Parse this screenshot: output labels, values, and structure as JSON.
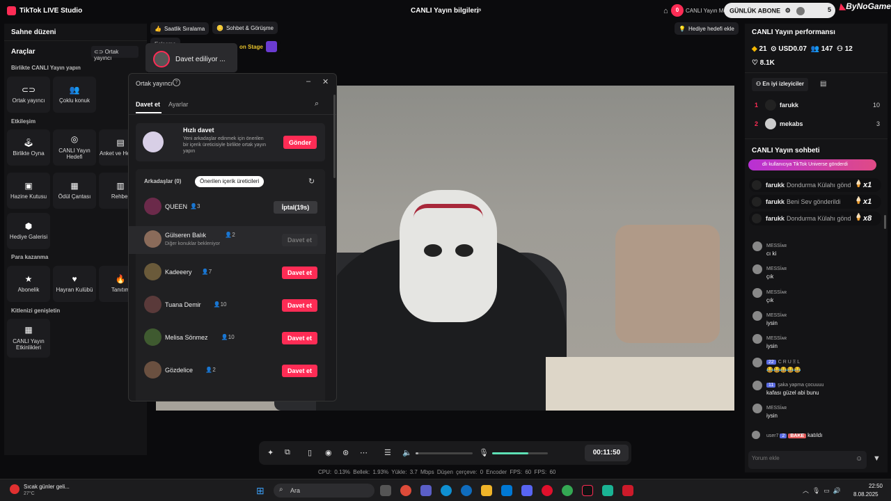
{
  "app": {
    "title": "TikTok LIVE Studio",
    "center_title": "CANLI Yayın bilgileri"
  },
  "topbar": {
    "notif_count": "0",
    "stream_label": "CANLI Yayın Merkezi",
    "banner": "GÜNLÜK ABONE",
    "count": "5",
    "watermark": "ByNoGame"
  },
  "left": {
    "title": "Sahne düzeni",
    "tools": "Araçlar",
    "cohost_link": "Ortak yayıncı",
    "g1": "Birlikte CANLI Yayın yapın",
    "t_cohost": "Ortak yayıncı",
    "t_multi": "Çoklu konuk",
    "g2": "Etkileşim",
    "t_play": "Birlikte Oyna",
    "t_goal": "CANLI Yayın Hedefi",
    "t_poll": "Anket ve Hediyeyi...",
    "t_treasure": "Hazine Kutusu",
    "t_reward": "Ödül Çantası",
    "t_guide": "Rehber",
    "t_gallery": "Hediye Galerisi",
    "g3": "Para kazanma",
    "t_sub": "Abonelik",
    "t_fan": "Hayran Kulübü",
    "t_promo": "Tanıtım",
    "g4": "Kitlenizi genişletin",
    "t_events": "CANLI Yayın Etkinlikleri"
  },
  "chips": {
    "hourly": "Saatlik Sıralama",
    "chat": "Sohbet & Görüşme",
    "match": "Eşleşme",
    "onstage": "on Stage",
    "invited": "Davet ediliyor ...",
    "gift_goal": "Hediye hedefi ekle"
  },
  "dialog": {
    "title": "Ortak yayıncı",
    "tab_invite": "Davet et",
    "tab_settings": "Ayarlar",
    "quick_title": "Hızlı davet",
    "quick_desc": "Yeni arkadaşlar edinmek için önerilen bir içerik üreticisiyle birlikte ortak yayın yapın",
    "send": "Gönder",
    "friends_tab": "Arkadaşlar (0)",
    "suggested_tab": "Önerilen içerik üreticileri",
    "rows": [
      {
        "name": "QUEEN",
        "count": "3",
        "action": "İptal(19s)",
        "sub": ""
      },
      {
        "name": "Gülseren Balık",
        "count": "2",
        "action": "Davet et",
        "sub": "Diğer konuklar bekleniyor"
      },
      {
        "name": "Kadeeery",
        "count": "7",
        "action": "Davet et",
        "sub": ""
      },
      {
        "name": "Tuana Demir",
        "count": "10",
        "action": "Davet et",
        "sub": ""
      },
      {
        "name": "Melisa Sönmez",
        "count": "10",
        "action": "Davet et",
        "sub": ""
      },
      {
        "name": "Gözdelice",
        "count": "2",
        "action": "Davet et",
        "sub": ""
      }
    ]
  },
  "bottom": {
    "timer": "00:11:50",
    "volume_pct": 0.05,
    "mic_pct": 0.65,
    "stats": "CPU: 0.13%  Bellek: 1.93%  Yükle: 3.7 Mbps  Düşen çerçeve: 0  Encoder FPS: 60  FPS: 60"
  },
  "right": {
    "perf_title": "CANLI Yayın performansı",
    "coins": "21",
    "usd": "USD0.07",
    "viewers": "147",
    "joined": "12",
    "likes": "8.1K",
    "top_viewers_btn": "En iyi izleyiciler",
    "top": [
      {
        "rank": "1",
        "name": "farukk",
        "score": "10"
      },
      {
        "rank": "2",
        "name": "mekabs",
        "score": "3"
      }
    ],
    "chat_title": "CANLI Yayın sohbeti",
    "universe": "dlı kullanıcıya TikTok Universe gönderdi",
    "gifts": [
      {
        "user": "farukk",
        "text": "Dondurma Külahı gönd",
        "mult": "x1"
      },
      {
        "user": "farukk",
        "text": "Beni Sev gönderildi",
        "mult": "x1"
      },
      {
        "user": "farukk",
        "text": "Dondurma Külahı gönd",
        "mult": "x8"
      }
    ],
    "messages": [
      {
        "user": "MESSİᴀʀ",
        "text": "cı ki",
        "badge": ""
      },
      {
        "user": "MESSİᴀʀ",
        "text": "çık",
        "badge": ""
      },
      {
        "user": "MESSİᴀʀ",
        "text": "çık",
        "badge": ""
      },
      {
        "user": "MESSİᴀʀ",
        "text": "iysin",
        "badge": ""
      },
      {
        "user": "MESSİᴀʀ",
        "text": "iysin",
        "badge": ""
      },
      {
        "user": "C R U Ξ L",
        "text": "😂😂😂😂😂",
        "badge": "22"
      },
      {
        "user": "şaka yapma çocuuuu",
        "text": "kafası güzel abi bunu",
        "badge": "11"
      },
      {
        "user": "MESSİᴀʀ",
        "text": "iysin",
        "badge": ""
      }
    ],
    "join_user": "user7",
    "join_badge": "2",
    "join_tag": "BAKE",
    "join_text": "katıldı",
    "comment_placeholder": "Yorum ekle"
  },
  "taskbar": {
    "weather_title": "Sıcak günler geli...",
    "weather_temp": "27°C",
    "search": "Ara",
    "time": "22:50",
    "date": "8.08.2025"
  },
  "colors": {
    "accent": "#fe2c55",
    "bg": "#0b0b0d",
    "panel": "#141416"
  }
}
